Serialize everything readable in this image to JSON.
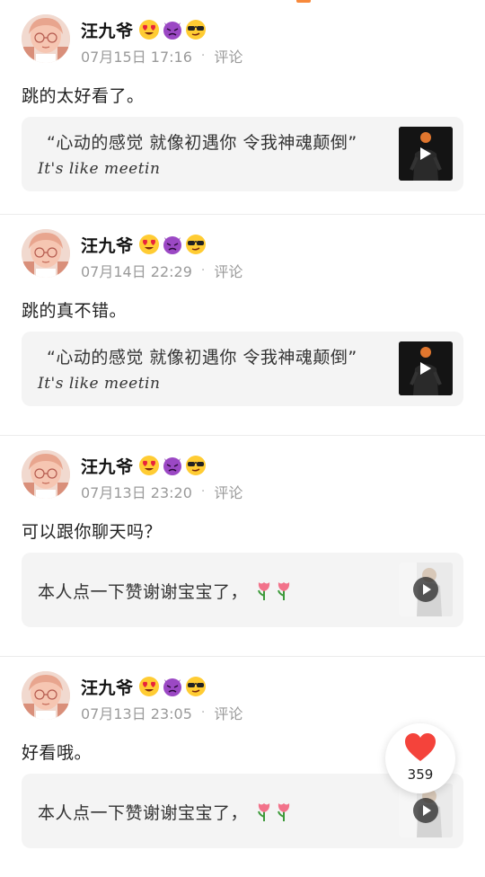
{
  "colors": {
    "accent": "#f7893b",
    "meta": "#9a9a9a",
    "card_bg": "#f4f4f4",
    "heart": "#f4433b"
  },
  "posts": [
    {
      "user": "汪九爷",
      "emoji_icons": [
        "heart-eyes-emoji-icon",
        "devil-emoji-icon",
        "sunglasses-emoji-icon"
      ],
      "date": "07月15日 17:16",
      "separator": "·",
      "comment_label": "评论",
      "content": "跳的太好看了。",
      "card": {
        "quote": "“心动的感觉 就像初遇你 令我神魂颠倒”",
        "script": "It's like meetin",
        "thumb_icon": "play-icon"
      }
    },
    {
      "user": "汪九爷",
      "emoji_icons": [
        "heart-eyes-emoji-icon",
        "devil-emoji-icon",
        "sunglasses-emoji-icon"
      ],
      "date": "07月14日 22:29",
      "separator": "·",
      "comment_label": "评论",
      "content": "跳的真不错。",
      "card": {
        "quote": "“心动的感觉 就像初遇你 令我神魂颠倒”",
        "script": "It's like meetin",
        "thumb_icon": "play-icon"
      }
    },
    {
      "user": "汪九爷",
      "emoji_icons": [
        "heart-eyes-emoji-icon",
        "devil-emoji-icon",
        "sunglasses-emoji-icon"
      ],
      "date": "07月13日 23:20",
      "separator": "·",
      "comment_label": "评论",
      "content": "可以跟你聊天吗？",
      "card": {
        "quote": "本人点一下赞谢谢宝宝了，",
        "thumb_icon": "play-icon"
      }
    },
    {
      "user": "汪九爷",
      "emoji_icons": [
        "heart-eyes-emoji-icon",
        "devil-emoji-icon",
        "sunglasses-emoji-icon"
      ],
      "date": "07月13日 23:05",
      "separator": "·",
      "comment_label": "评论",
      "content": "好看哦。",
      "card": {
        "quote": "本人点一下赞谢谢宝宝了，",
        "thumb_icon": "play-icon"
      }
    }
  ],
  "like_button": {
    "icon": "heart-icon",
    "count": "359"
  }
}
